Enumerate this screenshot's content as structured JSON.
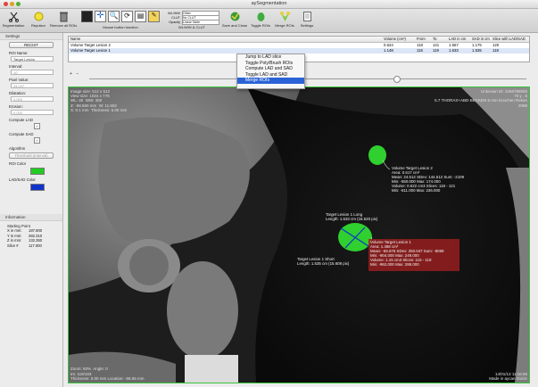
{
  "window": {
    "title": "aySegmentation"
  },
  "toolbar": {
    "buttons": [
      {
        "label": "Segmentation"
      },
      {
        "label": "Repulsor"
      },
      {
        "label": "Remove all ROIs"
      },
      {
        "label": "Mouse button function"
      },
      {
        "label": "Save and Close"
      },
      {
        "label": "Toggle ROIs"
      },
      {
        "label": "Merge ROIs"
      },
      {
        "label": "Settings"
      }
    ],
    "wl": {
      "wlww_label": "WL/WW",
      "wlww_value": "Other",
      "clut_label": "CLUT",
      "clut_value": "No CLUT",
      "opacity_label": "Opacity",
      "opacity_value": "Linear Table",
      "caption": "WL/WW & CLUT"
    }
  },
  "sidebar": {
    "settings_title": "Settings",
    "mode": "RECIST",
    "roi_name_label": "ROI Name:",
    "roi_name": "Target Lesion",
    "interval_label": "Interval:",
    "interval": "10",
    "pixel_value_label": "Pixel Value:",
    "pixel_value": "34.027",
    "dilatation_label": "Dilatation:",
    "dilatation": "4.000",
    "erosion_label": "Erosion:",
    "erosion": "0.000",
    "compute_lad_label": "Compute LAD",
    "compute_sad_label": "Compute SAD",
    "algorithm_label": "Algorithm",
    "algorithm": "Threshold (Interval)",
    "roi_color_label": "ROI Color",
    "roi_color": "#22cc22",
    "ladsad_color_label": "LAD/SAD Color",
    "ladsad_color": "#1133cc",
    "check_mark": "✓"
  },
  "info": {
    "title": "Information",
    "starting_point": "Starting Point",
    "rows": [
      {
        "k": "X in mm:",
        "v": "187.800"
      },
      {
        "k": "Y in mm:",
        "v": "282.310"
      },
      {
        "k": "Z in mm:",
        "v": "132.350"
      },
      {
        "k": "Slice #",
        "v": "117.000"
      }
    ]
  },
  "table": {
    "headers": [
      "Name",
      "Volume (cm³)",
      "From",
      "To",
      "LAD in cm",
      "SAD in cm",
      "Slice with LAD/SAD"
    ],
    "rows": [
      [
        "Volume Target Lesion 2",
        "0.624",
        "118",
        "121",
        "1.567",
        "1.175",
        "120"
      ],
      [
        "Volume Target Lesion 1",
        "1.148",
        "115",
        "119",
        "1.633",
        "1.535",
        "118"
      ]
    ],
    "add": "+",
    "remove": "−"
  },
  "context_menu": {
    "items": [
      "Jump to LAD slice",
      "Toggle Poly/Brush ROIs",
      "Compute LAD and SAD",
      "Toggle LAD and SAD",
      "Merge ROIs"
    ]
  },
  "viewer": {
    "top_left": "Image size: 512 x 512\nView size: 1024 x 776\nWL: 40  WW: 400\nZ: -58.560 mm  W: 11.602\nX: 0.1 mm  Thickness: 5.00 mm",
    "top_right": "Unknown ID: 3456789000\n70 y , 6\n5.7 THORAX+ABD-BECKEN 5 mm Knochen Rekon\n2098",
    "bottom_left": "Zoom: 93%  Angle: 0\nIm: 118/183\nThickness: 5.00 mm Location: -58.56 mm",
    "bottom_right": "14/01/13 11:16:56\nMade in aycan OsiriX",
    "lesion2_label": "Volume Target Lesion 2\nArea: 0.617 cm²\nMean: 24.512 SDev: 144.512 Sum: -2109\nMin: -550.000 Max: 174.000\nVolume: 0.622 cm3 Slices: 118 - 121\nMin: -511.000 Max: 236.000",
    "lesion1_long": "Target Lesion 1 Long\nLength: 1.633 cm (16.520 pix)",
    "lesion1_short": "Target Lesion 1 Short\nLength: 1.535 cm (15.608 pix)",
    "lesion1_label": "Volume Target Lesion 1\nArea: 1.488 cm²\nMean: -65.676 SDev: 250.047 Sum: -8059\nMin: -904.000 Max: 249.000\nVolume: 1.15 cm3 Slices: 115 - 119\nMin: -962.000 Max: 288.000"
  },
  "colors": {
    "accent": "#2b63d6",
    "roi": "#22cc22",
    "roi_box": "#962020"
  }
}
